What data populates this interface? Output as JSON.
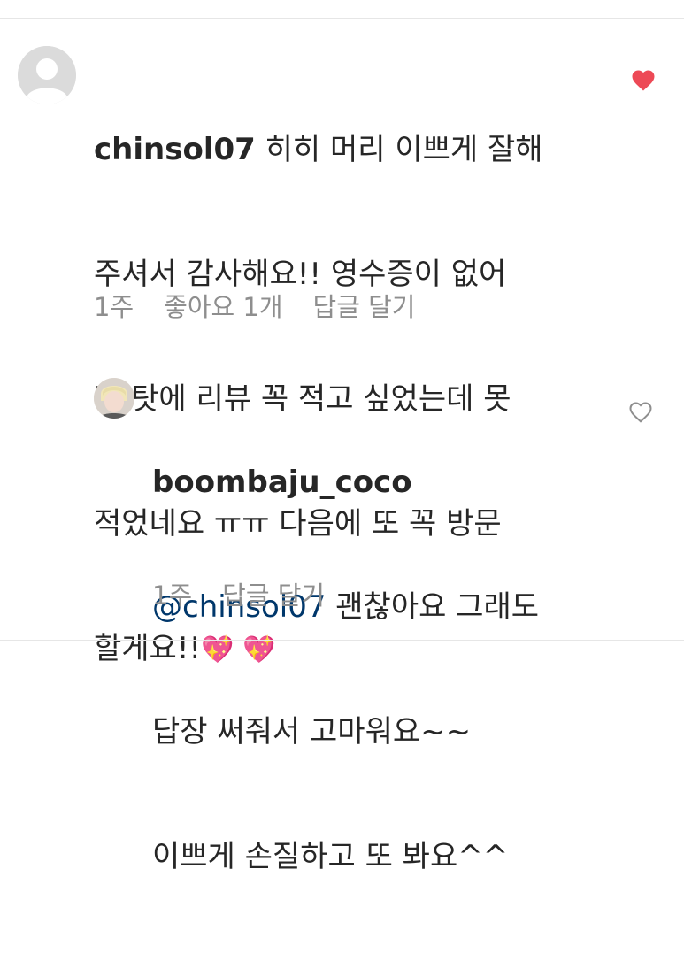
{
  "comments": [
    {
      "username": "chinsol07",
      "text_line1": "히히 머리 이쁘게 잘해",
      "text_line2": "주셔서 감사해요!! 영수증이 없어",
      "text_line3": "진 탓에 리뷰 꼭 적고 싶었는데 못",
      "text_line4": "적었네요 ㅠㅠ 다음에 또 꼭 방문",
      "text_line5": "할게요!!",
      "emoji": "💖 💖",
      "time": "1주",
      "likes": "좋아요 1개",
      "reply_label": "답글 달기",
      "liked": true,
      "like_color": "#ed4956",
      "avatar_icon": "default-user-avatar"
    },
    {
      "username": "boombaju_coco",
      "mention": "@chinsol07",
      "text_line1": "괜찮아요 그래도",
      "text_line2": "답장 써줘서 고마워요~~",
      "text_line3": "이쁘게 손질하고 또 봐요^^",
      "time": "1주",
      "reply_label": "답글 달기",
      "liked": false,
      "avatar_icon": "profile-photo-avatar"
    }
  ]
}
